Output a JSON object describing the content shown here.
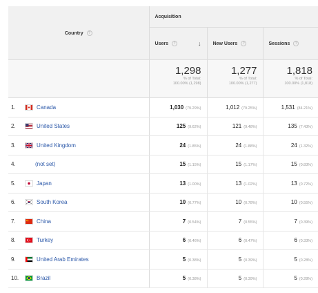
{
  "header": {
    "country_label": "Country",
    "group_label": "Acquisition",
    "columns": [
      "Users",
      "New Users",
      "Sessions"
    ]
  },
  "totals": [
    {
      "value": "1,298",
      "line1": "% of Total:",
      "line2": "100.00% (1,298)"
    },
    {
      "value": "1,277",
      "line1": "% of Total:",
      "line2": "100.00% (1,277)"
    },
    {
      "value": "1,818",
      "line1": "% of Total:",
      "line2": "100.00% (1,818)"
    }
  ],
  "rows": [
    {
      "num": "1.",
      "flag": "flag-canada",
      "name": "Canada",
      "users": "1,030",
      "users_pct": "(79.29%)",
      "new_users": "1,012",
      "new_users_pct": "(79.25%)",
      "sessions": "1,531",
      "sessions_pct": "(84.21%)"
    },
    {
      "num": "2.",
      "flag": "flag-united-states",
      "name": "United States",
      "users": "125",
      "users_pct": "(9.62%)",
      "new_users": "121",
      "new_users_pct": "(9.48%)",
      "sessions": "135",
      "sessions_pct": "(7.43%)"
    },
    {
      "num": "3.",
      "flag": "flag-united-kingdom",
      "name": "United Kingdom",
      "users": "24",
      "users_pct": "(1.85%)",
      "new_users": "24",
      "new_users_pct": "(1.88%)",
      "sessions": "24",
      "sessions_pct": "(1.32%)"
    },
    {
      "num": "4.",
      "flag": "",
      "name": "(not set)",
      "users": "15",
      "users_pct": "(1.15%)",
      "new_users": "15",
      "new_users_pct": "(1.17%)",
      "sessions": "15",
      "sessions_pct": "(0.83%)"
    },
    {
      "num": "5.",
      "flag": "flag-japan",
      "name": "Japan",
      "users": "13",
      "users_pct": "(1.00%)",
      "new_users": "13",
      "new_users_pct": "(1.02%)",
      "sessions": "13",
      "sessions_pct": "(0.72%)"
    },
    {
      "num": "6.",
      "flag": "flag-south-korea",
      "name": "South Korea",
      "users": "10",
      "users_pct": "(0.77%)",
      "new_users": "10",
      "new_users_pct": "(0.78%)",
      "sessions": "10",
      "sessions_pct": "(0.55%)"
    },
    {
      "num": "7.",
      "flag": "flag-china",
      "name": "China",
      "users": "7",
      "users_pct": "(0.54%)",
      "new_users": "7",
      "new_users_pct": "(0.55%)",
      "sessions": "7",
      "sessions_pct": "(0.39%)"
    },
    {
      "num": "8.",
      "flag": "flag-turkey",
      "name": "Turkey",
      "users": "6",
      "users_pct": "(0.46%)",
      "new_users": "6",
      "new_users_pct": "(0.47%)",
      "sessions": "6",
      "sessions_pct": "(0.33%)"
    },
    {
      "num": "9.",
      "flag": "flag-united-arab-emirates",
      "name": "United Arab Emirates",
      "users": "5",
      "users_pct": "(0.38%)",
      "new_users": "5",
      "new_users_pct": "(0.39%)",
      "sessions": "5",
      "sessions_pct": "(0.28%)"
    },
    {
      "num": "10.",
      "flag": "flag-brazil",
      "name": "Brazil",
      "users": "5",
      "users_pct": "(0.38%)",
      "new_users": "5",
      "new_users_pct": "(0.39%)",
      "sessions": "5",
      "sessions_pct": "(0.28%)"
    }
  ]
}
